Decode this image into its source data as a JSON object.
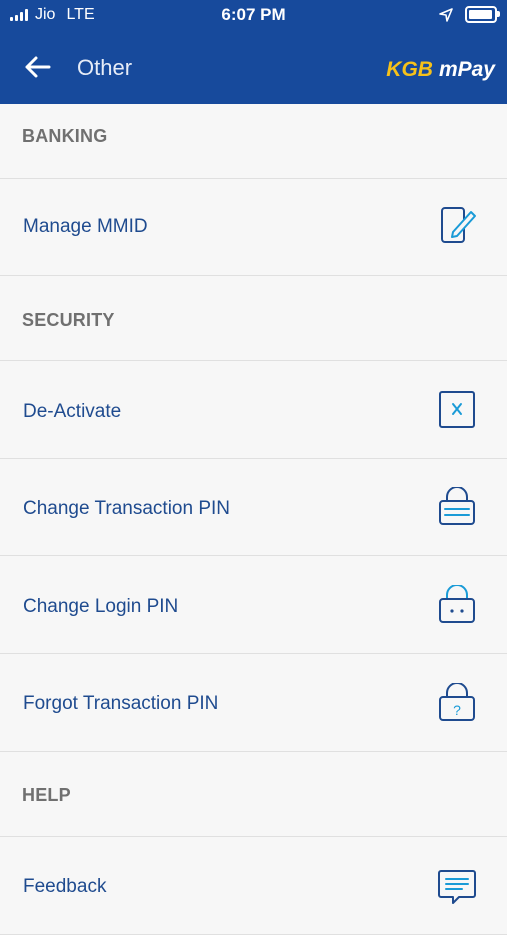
{
  "status_bar": {
    "carrier": "Jio",
    "network": "LTE",
    "time": "6:07 PM"
  },
  "header": {
    "title": "Other",
    "logo_kgb": "KGB",
    "logo_mpay": "mPay"
  },
  "sections": {
    "banking": {
      "title": "BANKING",
      "items": [
        {
          "label": "Manage MMID",
          "icon": "edit-phone-icon"
        }
      ]
    },
    "security": {
      "title": "SECURITY",
      "items": [
        {
          "label": "De-Activate",
          "icon": "deactivate-x-icon"
        },
        {
          "label": "Change Transaction PIN",
          "icon": "lock-lines-icon"
        },
        {
          "label": "Change Login PIN",
          "icon": "lock-dots-icon"
        },
        {
          "label": "Forgot Transaction PIN",
          "icon": "lock-question-icon"
        }
      ]
    },
    "help": {
      "title": "HELP",
      "items": [
        {
          "label": "Feedback",
          "icon": "feedback-chat-icon"
        }
      ]
    }
  },
  "colors": {
    "header_bg": "#174a9c",
    "accent_icon": "#1a9bd7",
    "item_text": "#1f4b8f",
    "section_text": "#707070",
    "logo_yellow": "#f6c11a"
  }
}
